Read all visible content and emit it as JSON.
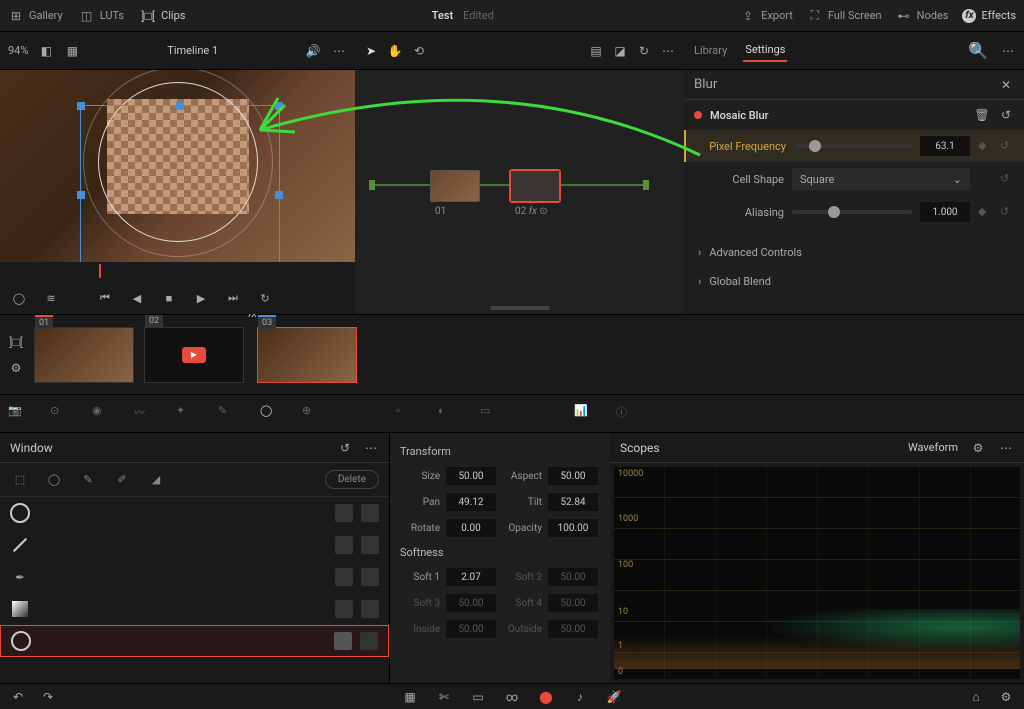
{
  "topbar": {
    "gallery": "Gallery",
    "luts": "LUTs",
    "clips": "Clips",
    "project": "Test",
    "status": "Edited",
    "export": "Export",
    "fullscreen": "Full Screen",
    "nodes": "Nodes",
    "effects": "Effects"
  },
  "secondbar": {
    "zoom": "94%",
    "timeline": "Timeline 1",
    "tabs": {
      "library": "Library",
      "settings": "Settings"
    }
  },
  "settings": {
    "search": "Blur",
    "effect": "Mosaic Blur",
    "pixfreq": {
      "label": "Pixel Frequency",
      "value": "63.1"
    },
    "cellshape": {
      "label": "Cell Shape",
      "value": "Square"
    },
    "aliasing": {
      "label": "Aliasing",
      "value": "1.000"
    },
    "advanced": "Advanced Controls",
    "blend": "Global Blend"
  },
  "nodes": {
    "n1": "01",
    "n2": "02"
  },
  "clips": {
    "c1": "01",
    "c2": "02",
    "c3": "03",
    "fx": "fx"
  },
  "window": {
    "title": "Window",
    "delete": "Delete"
  },
  "transform": {
    "title": "Transform",
    "size": {
      "l": "Size",
      "v": "50.00"
    },
    "pan": {
      "l": "Pan",
      "v": "49.12"
    },
    "rotate": {
      "l": "Rotate",
      "v": "0.00"
    },
    "aspect": {
      "l": "Aspect",
      "v": "50.00"
    },
    "tilt": {
      "l": "Tilt",
      "v": "52.84"
    },
    "opacity": {
      "l": "Opacity",
      "v": "100.00"
    },
    "softness": "Softness",
    "soft1": {
      "l": "Soft 1",
      "v": "2.07"
    },
    "soft2": {
      "l": "Soft 2",
      "v": "50.00"
    },
    "soft3": {
      "l": "Soft 3",
      "v": "50.00"
    },
    "soft4": {
      "l": "Soft 4",
      "v": "50.00"
    },
    "inside": {
      "l": "Inside",
      "v": "50.00"
    },
    "outside": {
      "l": "Outside",
      "v": "50.00"
    }
  },
  "scopes": {
    "title": "Scopes",
    "mode": "Waveform",
    "y1": "10000",
    "y2": "1000",
    "y3": "100",
    "y4": "10",
    "y5": "1",
    "y6": "0"
  }
}
